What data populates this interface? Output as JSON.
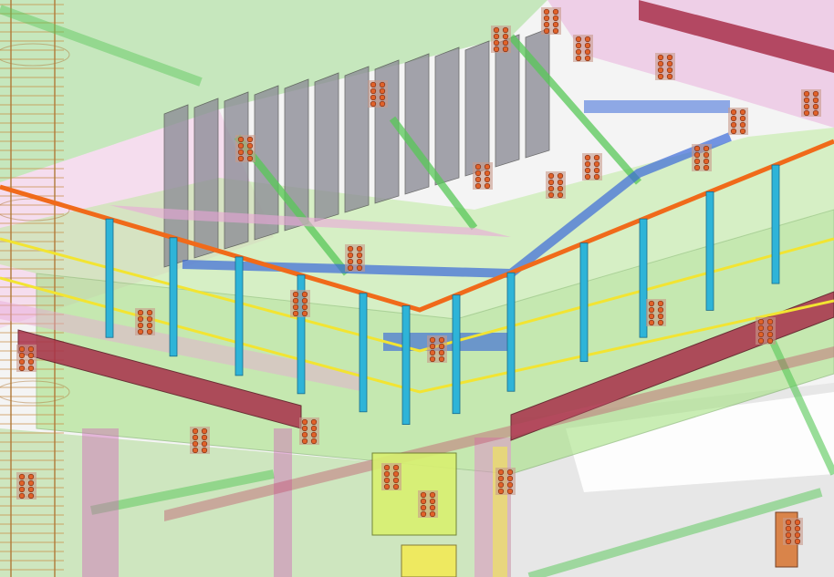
{
  "viewport": {
    "background": "#f4f4f4"
  },
  "colors": {
    "slab_green": "#9fe07a",
    "beam_maroon": "#a8304a",
    "beam_magenta": "#e9a6d8",
    "column_cyan": "#2eb4d8",
    "handrail_orange": "#f06a1a",
    "midrail_yellow": "#f2e432",
    "plate_grey": "#8c8c96",
    "bolt_orange": "#e0622a",
    "brace_green": "#58c858",
    "brace_blue": "#3a6ad8",
    "gusset_yellow": "#e8d840",
    "outline": "#4a4a4a"
  },
  "scene": {
    "description_visible": false,
    "vertical_plates": 13,
    "handrail_posts": 12,
    "bolted_connections": 26
  }
}
